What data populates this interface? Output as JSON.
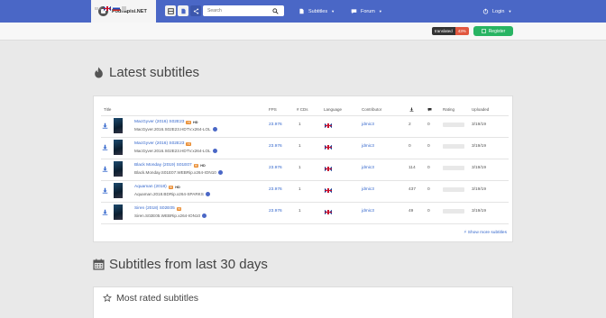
{
  "brand": {
    "name": "Podnapisi.NET"
  },
  "search": {
    "placeholder": "Search"
  },
  "nav": {
    "subtitles": "Subtitles",
    "forum": "Forum",
    "login": "Login"
  },
  "subbar": {
    "lang_prefix": "BUI",
    "translated_label": "translated",
    "translated_pct": "43%",
    "register_label": "Register"
  },
  "latest": {
    "heading": "Latest subtitles",
    "columns": [
      "Title",
      "FPS",
      "# CDs",
      "Language",
      "Contributor",
      "",
      "",
      "Rating",
      "Uploaded"
    ],
    "rows": [
      {
        "title": "MacGyver (2016) S02E23",
        "release": "MacGyver.2016.S02E23.HDTV.x264-LOL",
        "hd": "HD",
        "fps": "23.976",
        "cds": "1",
        "contributor": "jdmic3",
        "downloads": "2",
        "comments": "0",
        "uploaded": "3/19/19"
      },
      {
        "title": "MacGyver (2016) S02E23",
        "release": "MacGyver.2016.S02E23.HDTV.x264-LOL",
        "hd": "",
        "fps": "23.976",
        "cds": "1",
        "contributor": "jdmic3",
        "downloads": "0",
        "comments": "0",
        "uploaded": "3/19/19"
      },
      {
        "title": "Black Monday (2019) S01E07",
        "release": "Black.Monday.S01E07.WEBRip.x264-ION10",
        "hd": "HD",
        "fps": "23.976",
        "cds": "1",
        "contributor": "jdmic3",
        "downloads": "114",
        "comments": "0",
        "uploaded": "3/19/19"
      },
      {
        "title": "Aquaman (2018)",
        "release": "Aquaman.2018.BDRip.x264-SPARKS",
        "hd": "HD",
        "fps": "23.976",
        "cds": "1",
        "contributor": "jdmic3",
        "downloads": "437",
        "comments": "0",
        "uploaded": "3/19/19"
      },
      {
        "title": "Siren (2018) S02E05",
        "release": "Siren.S02E05.WEBRip.x264-ION10",
        "hd": "",
        "fps": "23.976",
        "cds": "1",
        "contributor": "jdmic3",
        "downloads": "49",
        "comments": "0",
        "uploaded": "3/19/19"
      }
    ],
    "more_link": "Show more subtitles"
  },
  "last30": {
    "heading": "Subtitles from last 30 days"
  },
  "most_rated": {
    "heading": "Most rated subtitles"
  },
  "colors": {
    "nav": "#4a67c6",
    "accent": "#28b463",
    "link": "#3366cc"
  }
}
